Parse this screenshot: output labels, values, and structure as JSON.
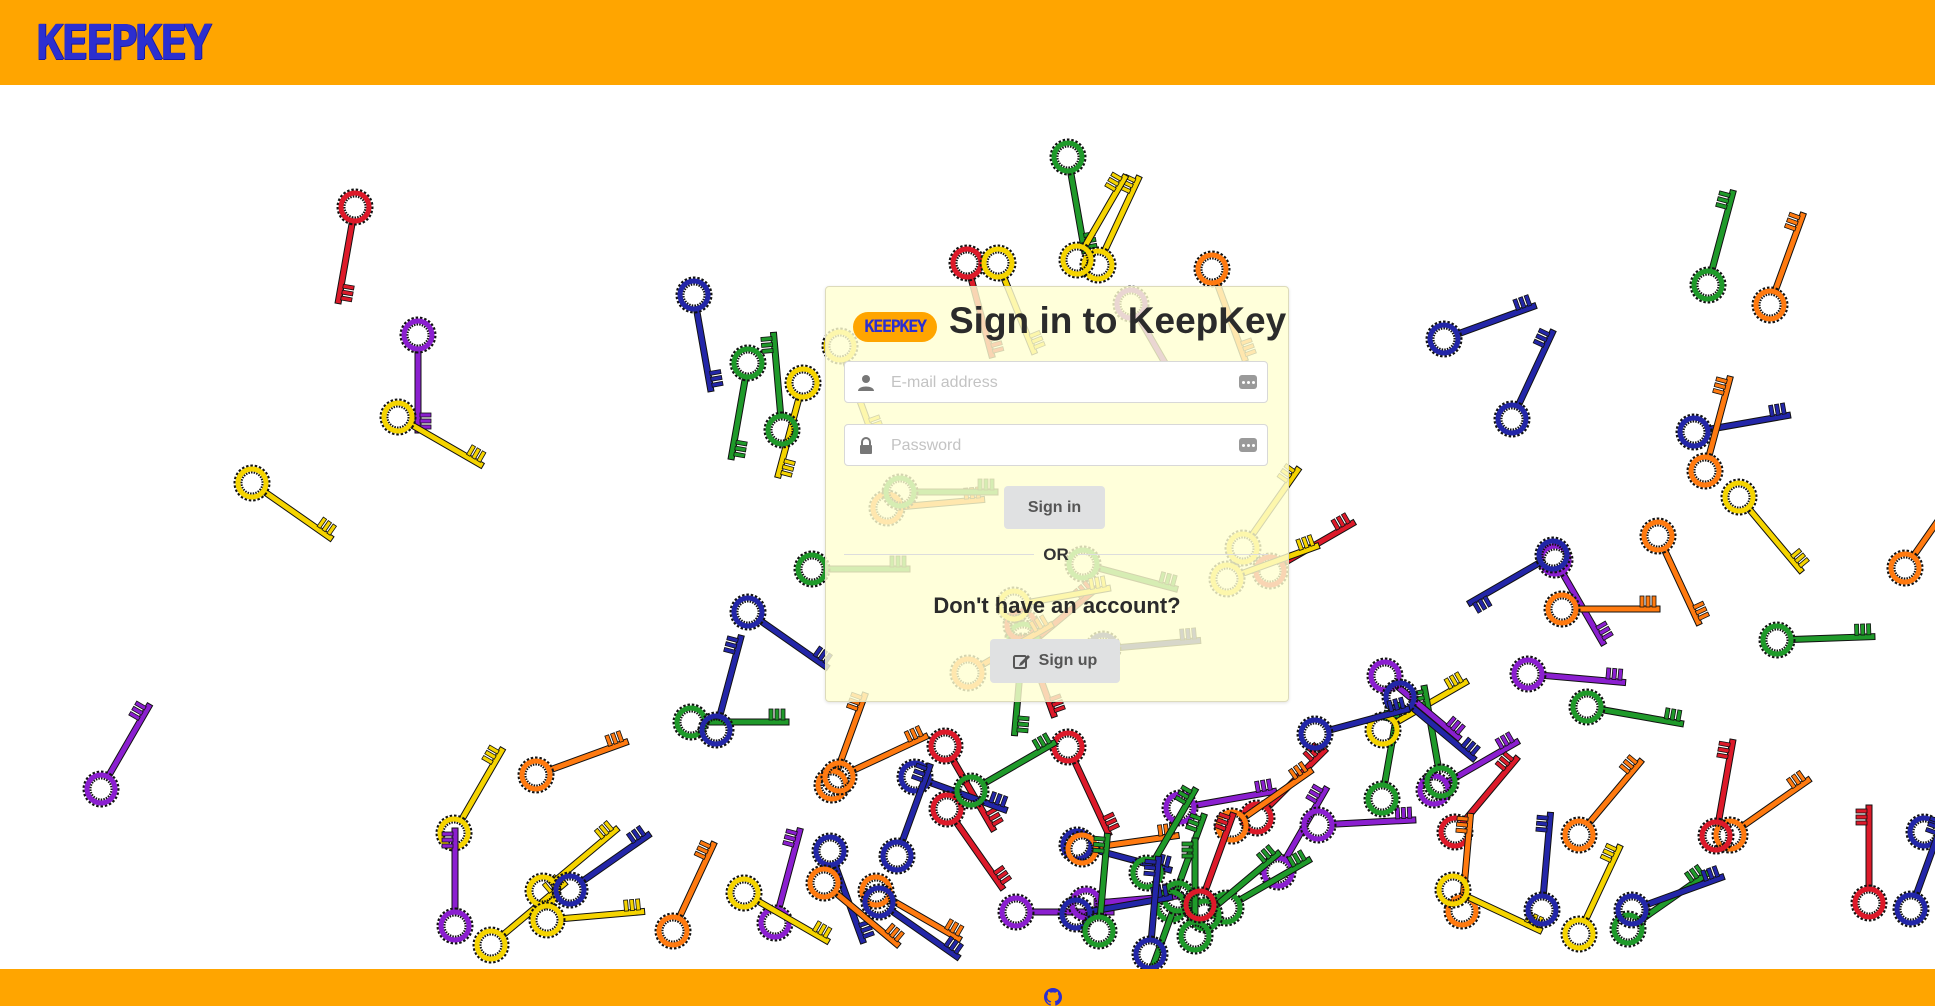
{
  "header": {
    "logo_text": "KEEPKEY"
  },
  "card": {
    "logo_text": "KEEPKEY",
    "title": "Sign in to KeepKey",
    "email_placeholder": "E-mail address",
    "password_placeholder": "Password",
    "signin_label": "Sign in",
    "or_label": "OR",
    "no_account_text": "Don't have an account?",
    "signup_label": "Sign up"
  },
  "footer": {
    "icon": "github-icon"
  },
  "colors": {
    "bar": "#ffa500",
    "logo": "#2c2fd0",
    "card_bg": "#ffffd2",
    "key_colors": [
      "#dd1a2a",
      "#8b1fd0",
      "#f5d400",
      "#2326a8",
      "#1f9a2a",
      "#ff7a10"
    ]
  }
}
